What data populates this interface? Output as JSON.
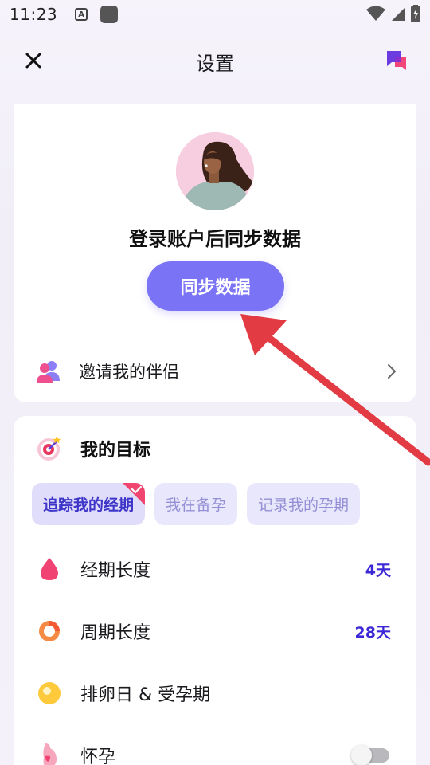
{
  "status_bar": {
    "time": "11:23",
    "notification_icon_text": "A"
  },
  "header": {
    "title": "设置",
    "close_icon": "close-icon",
    "chat_icon": "chat-bubbles-icon"
  },
  "account_card": {
    "sync_title": "登录账户后同步数据",
    "sync_button_label": "同步数据",
    "invite_label": "邀请我的伴侣"
  },
  "goals_card": {
    "title": "我的目标",
    "tabs": [
      {
        "label": "追踪我的经期",
        "active": true
      },
      {
        "label": "我在备孕",
        "active": false
      },
      {
        "label": "记录我的孕期",
        "active": false
      }
    ],
    "rows": [
      {
        "label": "经期长度",
        "value": "4天",
        "icon": "drop-icon"
      },
      {
        "label": "周期长度",
        "value": "28天",
        "icon": "cycle-icon"
      },
      {
        "label": "排卵日 & 受孕期",
        "value": "",
        "icon": "ovulation-icon"
      },
      {
        "label": "怀孕",
        "value": "",
        "icon": "pregnancy-icon",
        "toggle": false
      }
    ]
  },
  "colors": {
    "accent": "#7a73f5",
    "value_text": "#3d28d6",
    "annotation_arrow": "#e23b44"
  }
}
